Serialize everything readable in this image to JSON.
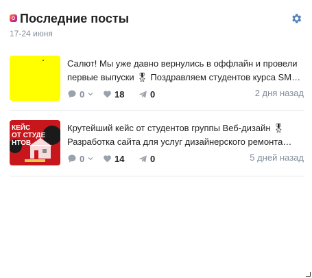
{
  "widget": {
    "title": "Последние посты",
    "date_range": "17-24 июня"
  },
  "icons": {
    "brand": "instagram-icon",
    "settings": "gear-icon",
    "comments": "comment-icon",
    "likes": "heart-icon",
    "shares": "share-icon",
    "dropdown": "chevron-down-icon"
  },
  "colors": {
    "accent": "#5181b8",
    "muted": "#818c99",
    "thumb_yellow": "#ffff00",
    "thumb_red": "#c8161d"
  },
  "posts": [
    {
      "text": "Салют! Мы уже давно вернулись в оффлайн и провели первые выпуски 🎖 Поздравляем студентов курса SMM с выпуском!",
      "comments": "0",
      "likes": "18",
      "shares": "0",
      "ago": "2 дня назад",
      "thumb_caption": ""
    },
    {
      "text": "Крутейший кейс от студентов группы Веб-дизайн 🎖 Разработка сайта для услуг дизайнерского ремонта квартир",
      "comments": "0",
      "likes": "14",
      "shares": "0",
      "ago": "5 дней назад",
      "thumb_caption": "КЕЙС ОТ СТУДЕНТОВ"
    }
  ]
}
